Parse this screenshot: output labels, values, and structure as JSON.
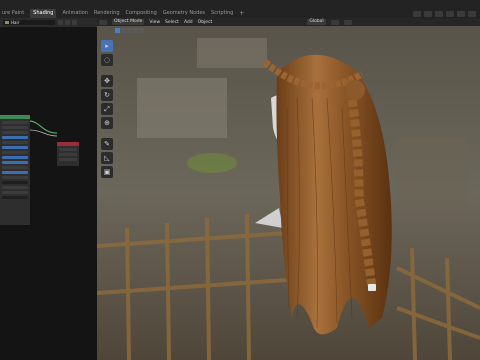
{
  "tabs": [
    {
      "label": "ure Paint",
      "active": false
    },
    {
      "label": "Shading",
      "active": true
    },
    {
      "label": "Animation",
      "active": false
    },
    {
      "label": "Rendering",
      "active": false
    },
    {
      "label": "Compositing",
      "active": false
    },
    {
      "label": "Geometry Nodes",
      "active": false
    },
    {
      "label": "Scripting",
      "active": false
    }
  ],
  "tab_add": "+",
  "node_editor": {
    "object_field": "Hair"
  },
  "viewport": {
    "mode": "Object Mode",
    "menus": [
      "View",
      "Select",
      "Add",
      "Object"
    ],
    "orientation": "Global"
  },
  "colors": {
    "active_tab": "#3c3c3c",
    "accent": "#4772b3",
    "node_green": "#3e8a56",
    "node_red": "#9b2c3c"
  },
  "tools": [
    "cursor-icon",
    "select-box-icon",
    "move-icon",
    "rotate-icon",
    "scale-icon",
    "transform-icon",
    "annotate-icon",
    "measure-icon",
    "add-cube-icon"
  ]
}
